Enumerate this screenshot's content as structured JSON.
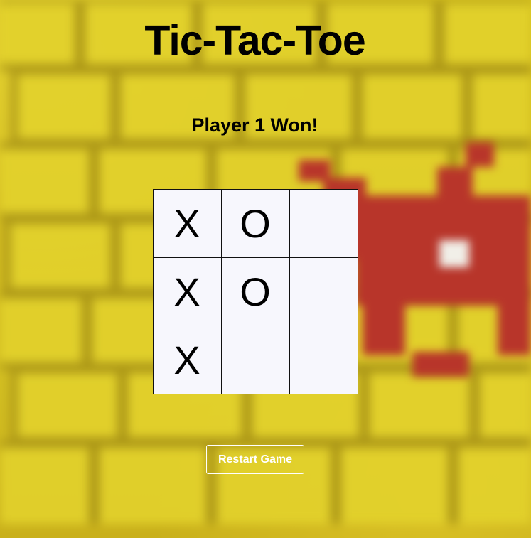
{
  "title": "Tic-Tac-Toe",
  "status": "Player 1 Won!",
  "board": {
    "cells": [
      "X",
      "O",
      "",
      "X",
      "O",
      "",
      "X",
      "",
      ""
    ]
  },
  "restart_label": "Restart Game",
  "colors": {
    "background_yellow": "#cfb91d",
    "invader_red": "#b8352a",
    "cell_background": "#f7f7fd",
    "restart_text": "#ffffff"
  }
}
